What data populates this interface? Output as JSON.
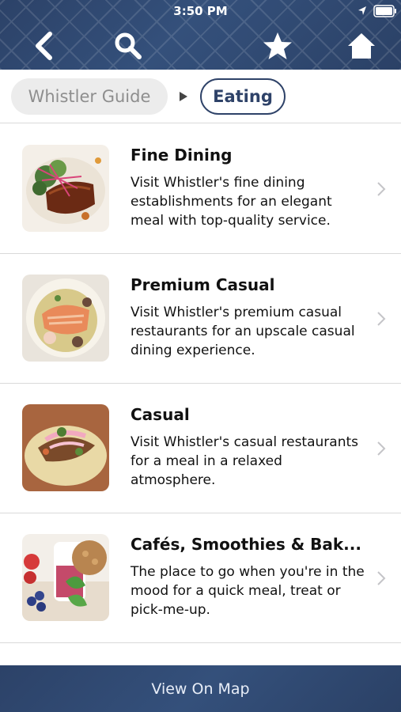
{
  "status": {
    "time": "3:50 PM"
  },
  "nav": {
    "back_icon": "chevron-left-icon",
    "search_icon": "search-icon",
    "favorite_icon": "star-icon",
    "home_icon": "home-icon"
  },
  "breadcrumb": {
    "parent": "Whistler Guide",
    "current": "Eating"
  },
  "items": [
    {
      "title": "Fine Dining",
      "description": "Visit Whistler's fine dining establishments for an elegant meal with top-quality service."
    },
    {
      "title": "Premium Casual",
      "description": "Visit Whistler's premium casual restaurants for an upscale casual dining experience."
    },
    {
      "title": "Casual",
      "description": "Visit Whistler's casual restaurants for a meal in a relaxed atmosphere."
    },
    {
      "title": "Cafés, Smoothies & Bak...",
      "description": "The place to go when you're in the mood for a quick meal, treat or pick-me-up."
    }
  ],
  "footer": {
    "map_button": "View On Map"
  },
  "colors": {
    "header_bg": "#2c4268",
    "accent": "#2e4268",
    "chip_bg": "#ececec"
  }
}
